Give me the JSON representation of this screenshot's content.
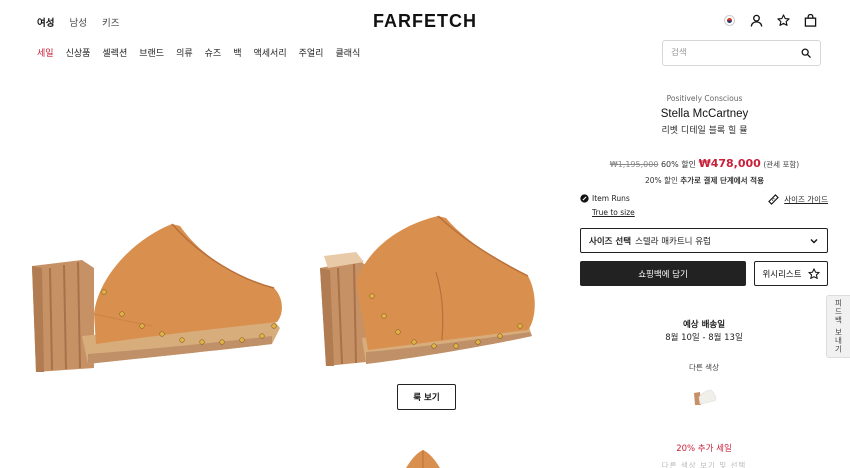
{
  "header": {
    "top_nav": [
      "여성",
      "남성",
      "키즈"
    ],
    "logo": "FARFETCH",
    "icons": [
      "korea-flag-icon",
      "account-icon",
      "star-icon",
      "shopping-bag-icon"
    ]
  },
  "categories": [
    "세일",
    "신상품",
    "셀렉션",
    "브랜드",
    "의류",
    "슈즈",
    "백",
    "액세서리",
    "주얼리",
    "클래식"
  ],
  "search": {
    "placeholder": "검색"
  },
  "gallery": {
    "look_button": "룩 보기"
  },
  "product": {
    "tag": "Positively Conscious",
    "brand": "Stella McCartney",
    "name": "리벳 디테일 블록 힐 뮬",
    "original_price": "₩1,195,000",
    "discount": "60% 할인",
    "price": "₩478,000",
    "tax_note": "(관세 포함)",
    "promo_prefix": "20% 할인",
    "promo_bold": "추가로 결제 단계에서 적용",
    "item_runs": "Item Runs",
    "true_to_size": "True to size",
    "size_guide": "사이즈 가이드",
    "size_label": "사이즈 선택",
    "size_system": "스텔라 매카트니 유럽",
    "add_to_bag": "쇼핑백에 담기",
    "wishlist": "위시리스트",
    "shipping_title": "예상 배송일",
    "shipping_dates": "8월 10일 - 8월 13일",
    "other_colors": "다른 색상",
    "extra_sale": "20% 추가 세일",
    "faded_text": "다른 색상 보기 및 선택"
  },
  "feedback": "피드백 보내기",
  "colors": {
    "sale_red": "#c81f3a",
    "leather": "#d98f4e",
    "sole": "#c79166"
  }
}
